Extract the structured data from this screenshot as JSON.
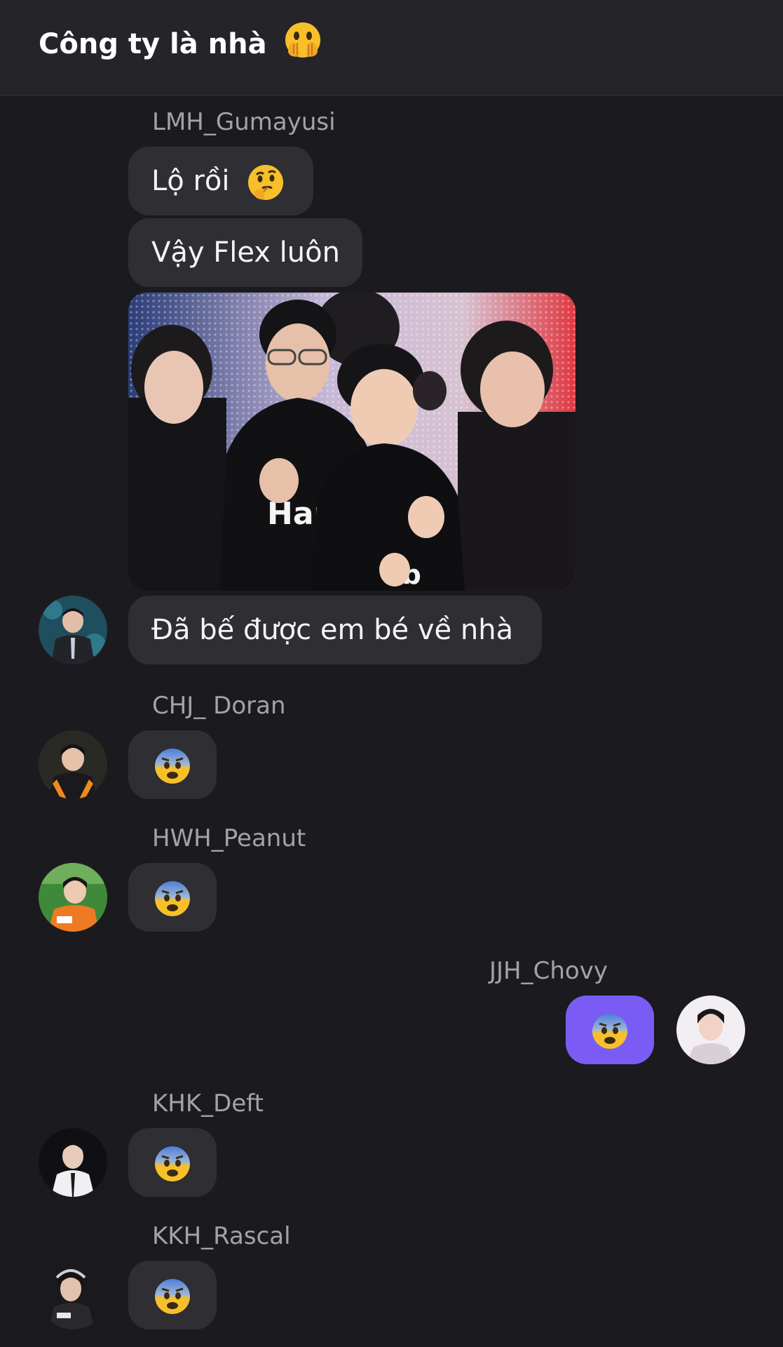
{
  "header": {
    "title": "Công ty là nhà"
  },
  "messages": {
    "gumayusi": {
      "sender": "LMH_Gumayusi",
      "msg1": "Lộ rồi",
      "msg2": "Vậy Flex luôn",
      "msg3": "Đã bế được em bé về nhà"
    },
    "doran": {
      "sender": "CHJ_ Doran",
      "text": "😨"
    },
    "peanut": {
      "sender": "HWH_Peanut",
      "text": "😨"
    },
    "chovy": {
      "sender": "JJH_Chovy",
      "text": "😨"
    },
    "deft": {
      "sender": "KHK_Deft",
      "text": "😨"
    },
    "rascal": {
      "sender": "KKH_Rascal",
      "text": "😨"
    }
  },
  "colors": {
    "background": "#1b1b1f",
    "header": "#252529",
    "bubble": "#2e2e33",
    "own_bubble": "#7a5cf5"
  },
  "icons": {
    "title_emoji": "face-with-open-eyes-and-hand-over-mouth-icon",
    "thinking_emoji": "thinking-face-icon",
    "fearful_emoji": "fearful-face-icon"
  }
}
